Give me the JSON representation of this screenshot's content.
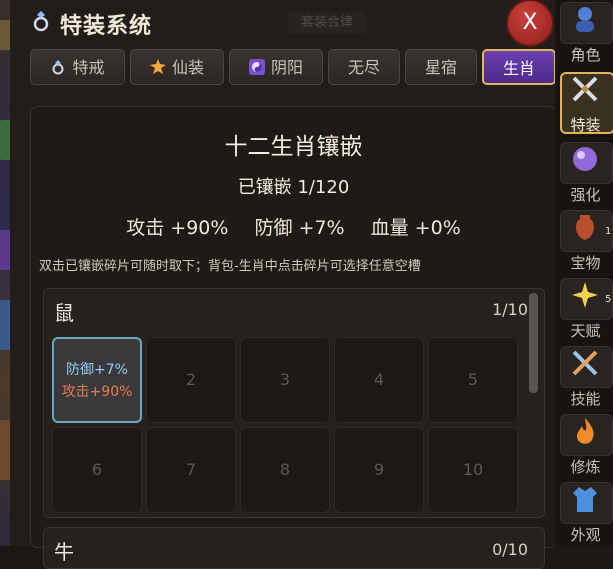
{
  "window": {
    "title": "特装系统",
    "background_title": "套装合律",
    "close_label": "X"
  },
  "tabs": [
    {
      "label": "特戒",
      "icon": "ring-icon",
      "active": false
    },
    {
      "label": "仙装",
      "icon": "sun-icon",
      "active": false
    },
    {
      "label": "阴阳",
      "icon": "yinyang-icon",
      "active": false
    },
    {
      "label": "无尽",
      "icon": "",
      "active": false
    },
    {
      "label": "星宿",
      "icon": "",
      "active": false
    },
    {
      "label": "生肖",
      "icon": "",
      "active": true
    }
  ],
  "panel": {
    "title": "十二生肖镶嵌",
    "inlaid_count": "已镶嵌 1/120",
    "stats": [
      "攻击 +90%",
      "防御 +7%",
      "血量 +0%"
    ],
    "hint": "双击已镶嵌碎片可随时取下；背包-生肖中点击碎片可选择任意空槽"
  },
  "sections": [
    {
      "name": "鼠",
      "progress": "1/10",
      "slots": [
        {
          "filled": true,
          "line1": "防御+7%",
          "line2": "攻击+90%"
        },
        {
          "filled": false,
          "label": "2"
        },
        {
          "filled": false,
          "label": "3"
        },
        {
          "filled": false,
          "label": "4"
        },
        {
          "filled": false,
          "label": "5"
        },
        {
          "filled": false,
          "label": "6"
        },
        {
          "filled": false,
          "label": "7"
        },
        {
          "filled": false,
          "label": "8"
        },
        {
          "filled": false,
          "label": "9"
        },
        {
          "filled": false,
          "label": "10"
        }
      ]
    },
    {
      "name": "牛",
      "progress": "0/10"
    }
  ],
  "sidebar": [
    {
      "label": "角色",
      "icon": "character-icon",
      "active": false
    },
    {
      "label": "特装",
      "icon": "crossed-swords-icon",
      "active": true
    },
    {
      "label": "强化",
      "icon": "purple-orb-icon",
      "active": false
    },
    {
      "label": "宝物",
      "icon": "vase-icon",
      "active": false,
      "badge": "1"
    },
    {
      "label": "天赋",
      "icon": "sparkle-icon",
      "active": false,
      "badge": "5"
    },
    {
      "label": "技能",
      "icon": "swords-icon",
      "active": false
    },
    {
      "label": "修炼",
      "icon": "flame-icon",
      "active": false
    },
    {
      "label": "外观",
      "icon": "robe-icon",
      "active": false
    }
  ],
  "colors": {
    "accent_gold": "#e0b560",
    "active_tab_purple": "#5c35a0",
    "close_red": "#b8322c",
    "defense_blue": "#8fd0f2",
    "attack_orange": "#e87a5a"
  }
}
